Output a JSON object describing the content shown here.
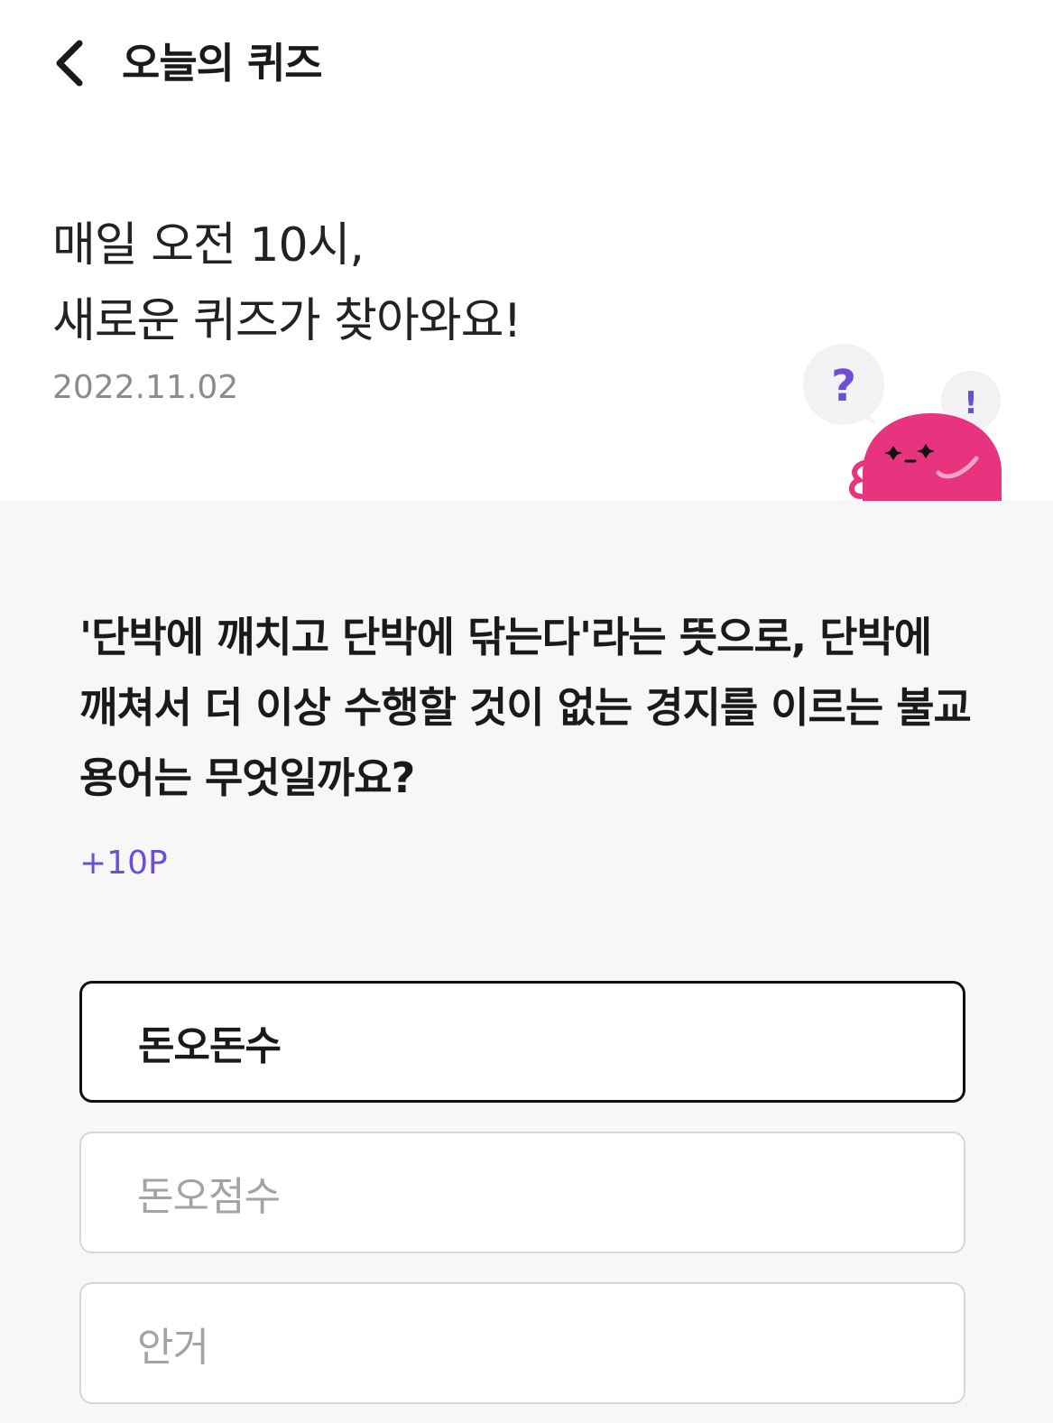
{
  "header": {
    "title": "오늘의 퀴즈",
    "back_icon": "chevron-left-icon"
  },
  "intro": {
    "line1": "매일 오전 10시,",
    "line2": "새로운 퀴즈가 찾아와요!",
    "date": "2022.11.02"
  },
  "mascot": {
    "question_mark": "?",
    "exclamation_mark": "!",
    "body_color": "#e8337f",
    "bubble_color": "#f2f2f4",
    "question_color": "#6c4fd6"
  },
  "quiz": {
    "question": "'단박에 깨치고 단박에 닦는다'라는 뜻으로, 단박에 깨쳐서 더 이상 수행할 것이 없는 경지를 이르는 불교 용어는 무엇일까요?",
    "points": "+10P",
    "options": [
      {
        "label": "돈오돈수",
        "selected": true
      },
      {
        "label": "돈오점수",
        "selected": false
      },
      {
        "label": "안거",
        "selected": false
      }
    ]
  },
  "colors": {
    "accent": "#6c4fd6",
    "quiz_background": "#f7f7f7",
    "selected_border": "#111111",
    "option_border": "#d6d6d6"
  }
}
